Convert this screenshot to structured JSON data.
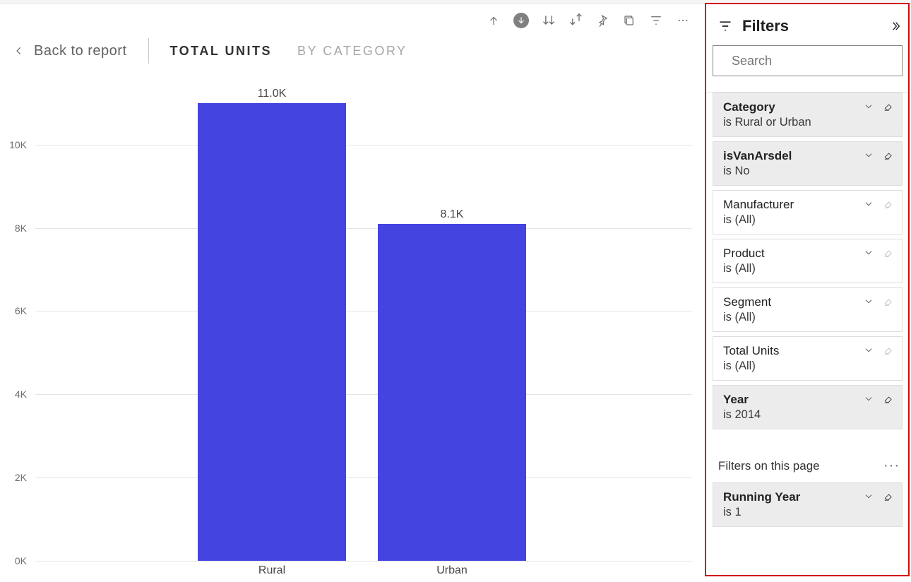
{
  "nav": {
    "back_label": "Back to report",
    "tabs": [
      {
        "label": "TOTAL UNITS",
        "active": true
      },
      {
        "label": "BY CATEGORY",
        "active": false
      }
    ]
  },
  "chart_data": {
    "type": "bar",
    "categories": [
      "Rural",
      "Urban"
    ],
    "values": [
      11000,
      8100
    ],
    "data_labels": [
      "11.0K",
      "8.1K"
    ],
    "y_ticks": [
      0,
      2000,
      4000,
      6000,
      8000,
      10000
    ],
    "y_tick_labels": [
      "0K",
      "2K",
      "4K",
      "6K",
      "8K",
      "10K"
    ],
    "ylim": [
      0,
      11200
    ],
    "bar_color": "#4444e0"
  },
  "filters_pane": {
    "title": "Filters",
    "search_placeholder": "Search",
    "visual_filters": [
      {
        "name": "Category",
        "sub": "is Rural or Urban",
        "applied": true
      },
      {
        "name": "isVanArsdel",
        "sub": "is No",
        "applied": true
      },
      {
        "name": "Manufacturer",
        "sub": "is (All)",
        "applied": false
      },
      {
        "name": "Product",
        "sub": "is (All)",
        "applied": false
      },
      {
        "name": "Segment",
        "sub": "is (All)",
        "applied": false
      },
      {
        "name": "Total Units",
        "sub": "is (All)",
        "applied": false
      },
      {
        "name": "Year",
        "sub": "is 2014",
        "applied": true
      }
    ],
    "page_filters_heading": "Filters on this page",
    "page_filters": [
      {
        "name": "Running Year",
        "sub": "is 1",
        "applied": true
      }
    ]
  }
}
